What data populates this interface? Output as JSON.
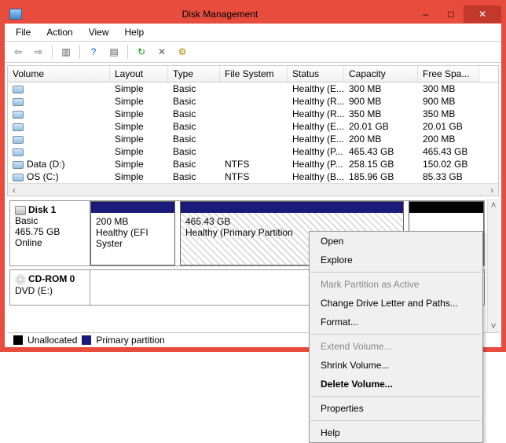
{
  "title": "Disk Management",
  "window_buttons": {
    "minimize": "–",
    "maximize": "□",
    "close": "✕"
  },
  "menubar": [
    "File",
    "Action",
    "View",
    "Help"
  ],
  "toolbar_icons": [
    "back-arrow-icon",
    "forward-arrow-icon",
    "show-hide-tree-icon",
    "help-icon",
    "properties-icon",
    "refresh-icon",
    "delete-icon",
    "settings-icon"
  ],
  "columns": [
    "Volume",
    "Layout",
    "Type",
    "File System",
    "Status",
    "Capacity",
    "Free Spa..."
  ],
  "volumes": [
    {
      "name": "",
      "layout": "Simple",
      "type": "Basic",
      "fs": "",
      "status": "Healthy (E...",
      "capacity": "300 MB",
      "free": "300 MB"
    },
    {
      "name": "",
      "layout": "Simple",
      "type": "Basic",
      "fs": "",
      "status": "Healthy (R...",
      "capacity": "900 MB",
      "free": "900 MB"
    },
    {
      "name": "",
      "layout": "Simple",
      "type": "Basic",
      "fs": "",
      "status": "Healthy (R...",
      "capacity": "350 MB",
      "free": "350 MB"
    },
    {
      "name": "",
      "layout": "Simple",
      "type": "Basic",
      "fs": "",
      "status": "Healthy (E...",
      "capacity": "20.01 GB",
      "free": "20.01 GB"
    },
    {
      "name": "",
      "layout": "Simple",
      "type": "Basic",
      "fs": "",
      "status": "Healthy (E...",
      "capacity": "200 MB",
      "free": "200 MB"
    },
    {
      "name": "",
      "layout": "Simple",
      "type": "Basic",
      "fs": "",
      "status": "Healthy (P...",
      "capacity": "465.43 GB",
      "free": "465.43 GB"
    },
    {
      "name": "Data (D:)",
      "layout": "Simple",
      "type": "Basic",
      "fs": "NTFS",
      "status": "Healthy (P...",
      "capacity": "258.15 GB",
      "free": "150.02 GB"
    },
    {
      "name": "OS (C:)",
      "layout": "Simple",
      "type": "Basic",
      "fs": "NTFS",
      "status": "Healthy (B...",
      "capacity": "185.96 GB",
      "free": "85.33 GB"
    }
  ],
  "disk1": {
    "name": "Disk 1",
    "type": "Basic",
    "size": "465.75 GB",
    "status": "Online",
    "part_a": {
      "size": "200 MB",
      "desc": "Healthy (EFI Syster"
    },
    "part_b": {
      "size": "465.43 GB",
      "desc": "Healthy (Primary Partition"
    }
  },
  "cdrom": {
    "name": "CD-ROM 0",
    "type": "DVD (E:)"
  },
  "legend": {
    "unallocated": "Unallocated",
    "primary": "Primary partition"
  },
  "context_menu": {
    "open": "Open",
    "explore": "Explore",
    "mark_active": "Mark Partition as Active",
    "change_letter": "Change Drive Letter and Paths...",
    "format": "Format...",
    "extend": "Extend Volume...",
    "shrink": "Shrink Volume...",
    "delete": "Delete Volume...",
    "properties": "Properties",
    "help": "Help"
  }
}
